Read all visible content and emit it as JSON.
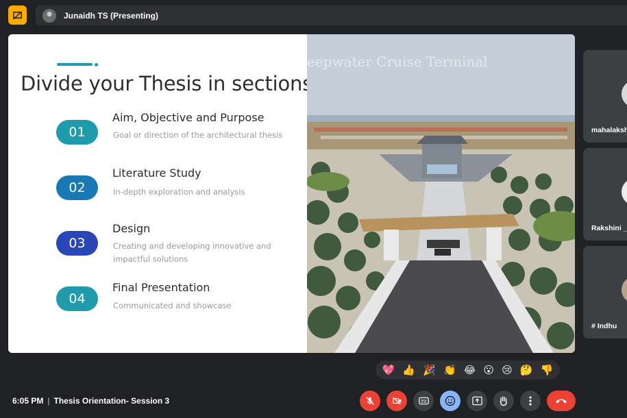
{
  "header": {
    "presenter_label": "Junaidh TS (Presenting)"
  },
  "slide": {
    "title": "Divide your Thesis in sections",
    "render_caption": "eepwater Cruise Terminal",
    "sections": [
      {
        "number": "01",
        "heading": "Aim, Objective and Purpose",
        "description": "Goal or direction of the architectural thesis",
        "color": "#1f9bab"
      },
      {
        "number": "02",
        "heading": "Literature Study",
        "description": "In-depth exploration and analysis",
        "color": "#1a79b5"
      },
      {
        "number": "03",
        "heading": "Design",
        "description": "Creating and developing innovative and impactful solutions",
        "color": "#2a47b8"
      },
      {
        "number": "04",
        "heading": "Final Presentation",
        "description": "Communicated and showcase",
        "color": "#1f9bab"
      }
    ]
  },
  "participants": [
    {
      "name": "mahalakshmi"
    },
    {
      "name": "Rakshini _"
    },
    {
      "name": "# Indhu"
    }
  ],
  "reactions": [
    "💖",
    "👍",
    "🎉",
    "👏",
    "😂",
    "😮",
    "😢",
    "🤔",
    "👎"
  ],
  "footer": {
    "time": "6:05 PM",
    "meeting_title": "Thesis Orientation- Session 3"
  },
  "colors": {
    "background": "#202124",
    "accent": "#f9ab00",
    "danger": "#ea4335",
    "active": "#8ab4f8"
  }
}
